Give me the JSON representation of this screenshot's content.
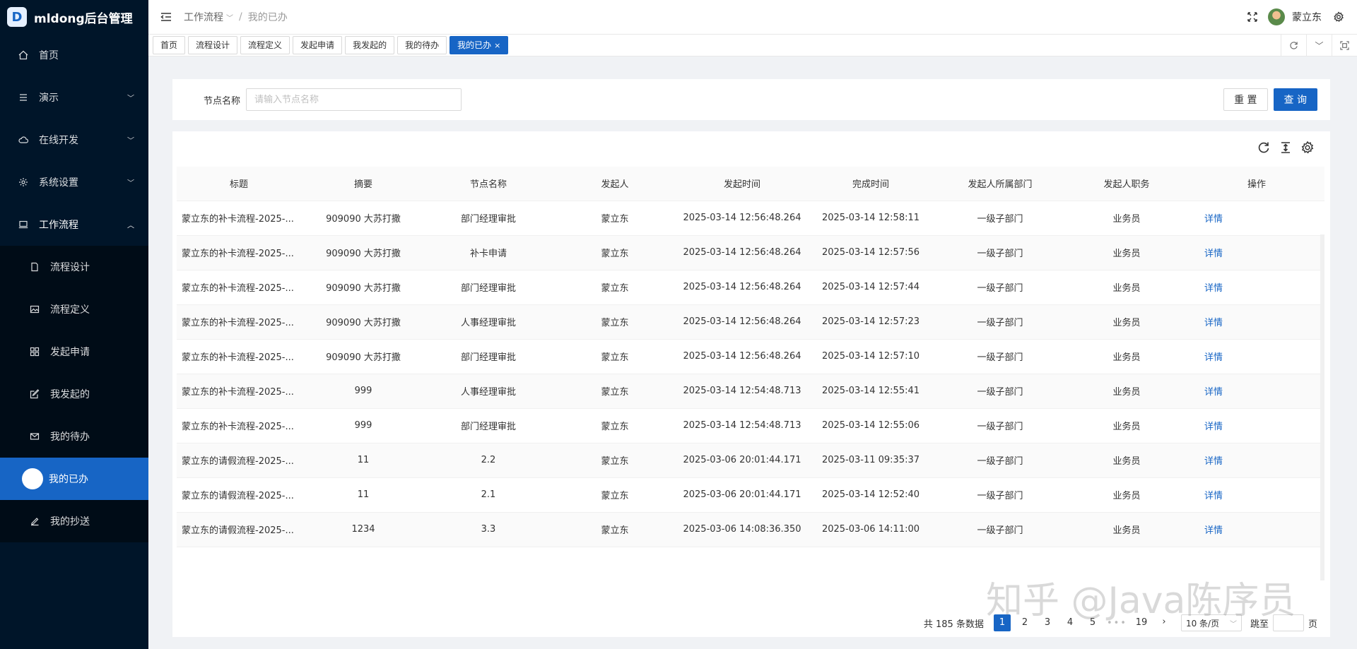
{
  "app": {
    "logo_mark": "D",
    "title": "mldong后台管理"
  },
  "sidebar": {
    "items": [
      {
        "label": "首页",
        "icon": "home-icon"
      },
      {
        "label": "演示",
        "icon": "menu-lines-icon"
      },
      {
        "label": "在线开发",
        "icon": "cloud-icon"
      },
      {
        "label": "系统设置",
        "icon": "gear-icon"
      },
      {
        "label": "工作流程",
        "icon": "laptop-icon"
      }
    ],
    "submenu": [
      {
        "label": "流程设计",
        "icon": "file-icon"
      },
      {
        "label": "流程定义",
        "icon": "image-icon"
      },
      {
        "label": "发起申请",
        "icon": "grid-icon"
      },
      {
        "label": "我发起的",
        "icon": "edit-icon"
      },
      {
        "label": "我的待办",
        "icon": "mail-icon"
      },
      {
        "label": "我的已办",
        "icon": "circle-icon"
      },
      {
        "label": "我的抄送",
        "icon": "pen-icon"
      }
    ]
  },
  "header": {
    "breadcrumb": [
      "工作流程",
      "我的已办"
    ],
    "username": "蒙立东"
  },
  "tabs": [
    "首页",
    "流程设计",
    "流程定义",
    "发起申请",
    "我发起的",
    "我的待办",
    "我的已办"
  ],
  "search": {
    "label": "节点名称",
    "placeholder": "请输入节点名称",
    "reset_label": "重 置",
    "query_label": "查 询"
  },
  "table": {
    "columns": [
      "标题",
      "摘要",
      "节点名称",
      "发起人",
      "发起时间",
      "完成时间",
      "发起人所属部门",
      "发起人职务",
      "操作"
    ],
    "rows": [
      [
        "蒙立东的补卡流程-2025-...",
        "909090 大苏打撒",
        "部门经理审批",
        "蒙立东",
        "2025-03-14 12:56:48.264",
        "2025-03-14 12:58:11",
        "一级子部门",
        "业务员",
        "详情"
      ],
      [
        "蒙立东的补卡流程-2025-...",
        "909090 大苏打撒",
        "补卡申请",
        "蒙立东",
        "2025-03-14 12:56:48.264",
        "2025-03-14 12:57:56",
        "一级子部门",
        "业务员",
        "详情"
      ],
      [
        "蒙立东的补卡流程-2025-...",
        "909090 大苏打撒",
        "部门经理审批",
        "蒙立东",
        "2025-03-14 12:56:48.264",
        "2025-03-14 12:57:44",
        "一级子部门",
        "业务员",
        "详情"
      ],
      [
        "蒙立东的补卡流程-2025-...",
        "909090 大苏打撒",
        "人事经理审批",
        "蒙立东",
        "2025-03-14 12:56:48.264",
        "2025-03-14 12:57:23",
        "一级子部门",
        "业务员",
        "详情"
      ],
      [
        "蒙立东的补卡流程-2025-...",
        "909090 大苏打撒",
        "部门经理审批",
        "蒙立东",
        "2025-03-14 12:56:48.264",
        "2025-03-14 12:57:10",
        "一级子部门",
        "业务员",
        "详情"
      ],
      [
        "蒙立东的补卡流程-2025-...",
        "999",
        "人事经理审批",
        "蒙立东",
        "2025-03-14 12:54:48.713",
        "2025-03-14 12:55:41",
        "一级子部门",
        "业务员",
        "详情"
      ],
      [
        "蒙立东的补卡流程-2025-...",
        "999",
        "部门经理审批",
        "蒙立东",
        "2025-03-14 12:54:48.713",
        "2025-03-14 12:55:06",
        "一级子部门",
        "业务员",
        "详情"
      ],
      [
        "蒙立东的请假流程-2025-...",
        "11",
        "2.2",
        "蒙立东",
        "2025-03-06 20:01:44.171",
        "2025-03-11 09:35:37",
        "一级子部门",
        "业务员",
        "详情"
      ],
      [
        "蒙立东的请假流程-2025-...",
        "11",
        "2.1",
        "蒙立东",
        "2025-03-06 20:01:44.171",
        "2025-03-14 12:52:40",
        "一级子部门",
        "业务员",
        "详情"
      ],
      [
        "蒙立东的请假流程-2025-...",
        "1234",
        "3.3",
        "蒙立东",
        "2025-03-06 14:08:36.350",
        "2025-03-06 14:11:00",
        "一级子部门",
        "业务员",
        "详情"
      ]
    ]
  },
  "pagination": {
    "total_text": "共 185 条数据",
    "pages": [
      "1",
      "2",
      "3",
      "4",
      "5"
    ],
    "ellipsis": "•••",
    "last_page": "19",
    "page_size": "10 条/页",
    "jump_label": "跳至",
    "page_suffix": "页"
  },
  "watermark": "知乎 @Java陈序员"
}
